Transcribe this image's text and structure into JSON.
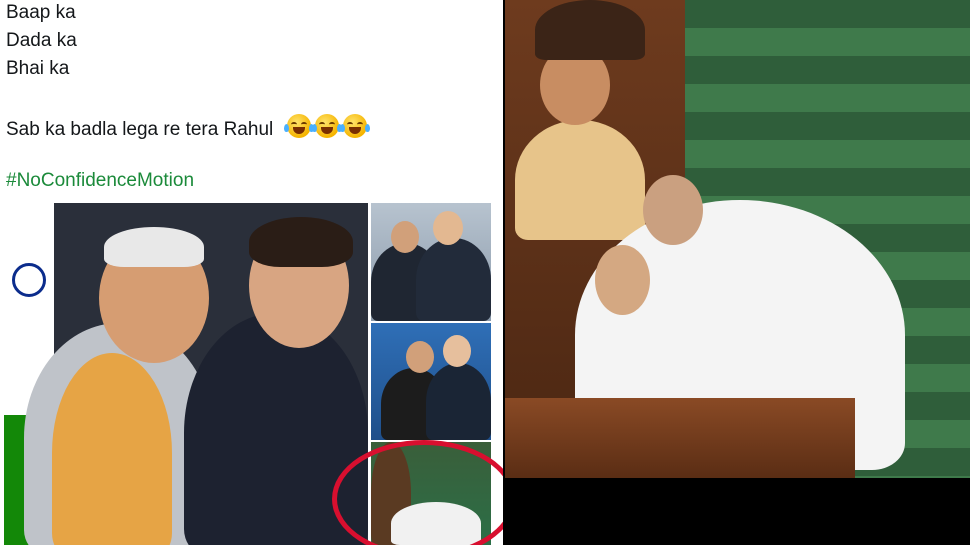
{
  "post": {
    "lines": [
      "Baap ka",
      "Dada ka",
      "Bhai ka"
    ],
    "badla_line": "Sab ka badla lega re tera Rahul",
    "emojis": [
      "joy-tears-emoji",
      "joy-tears-emoji",
      "joy-tears-emoji"
    ],
    "hashtag": "#NoConfidenceMotion"
  },
  "colors": {
    "hashtag": "#1b8a3a",
    "highlight_circle": "#d80f2f",
    "text": "#14171a"
  },
  "images": {
    "main": "hug-photo-main",
    "thumbnails": [
      "hug-thumb-1",
      "hug-thumb-2",
      "hug-thumb-3-highlighted"
    ],
    "right": "parliament-hug-photo"
  }
}
